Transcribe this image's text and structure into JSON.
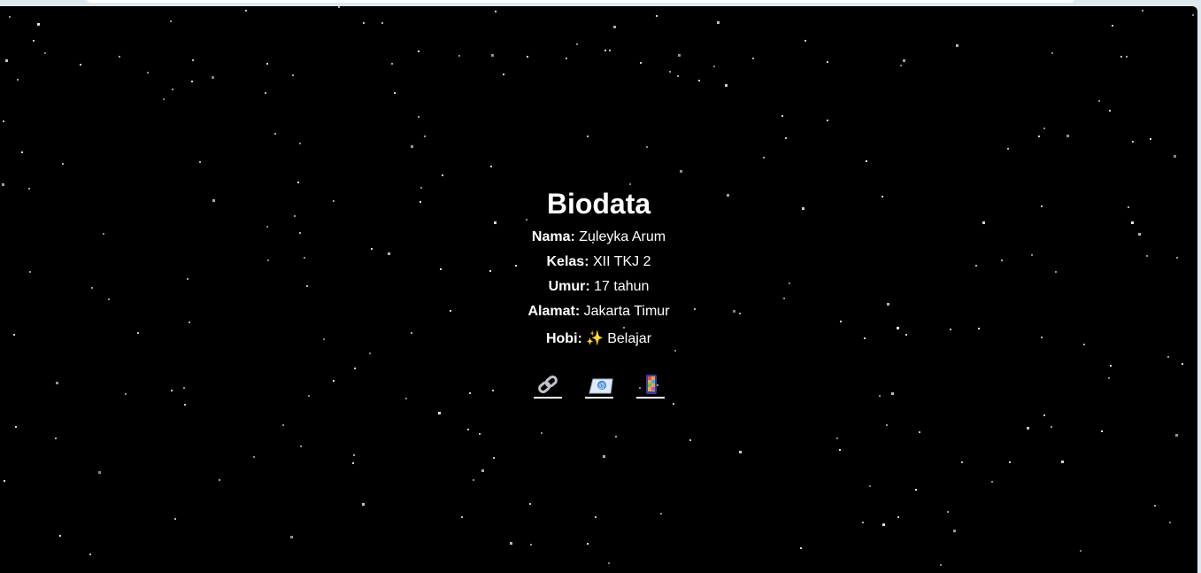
{
  "biodata": {
    "title": "Biodata",
    "rows": [
      {
        "label": "Nama:",
        "value": "Zuleyka Arum"
      },
      {
        "label": "Kelas:",
        "value": "XII TKJ 2"
      },
      {
        "label": "Umur:",
        "value": "17 tahun"
      },
      {
        "label": "Alamat:",
        "value": "Jakarta Timur"
      }
    ],
    "hobi": {
      "label": "Hobi:",
      "icon": "sparkles-icon",
      "value": "Belajar"
    }
  },
  "links": [
    {
      "icon": "link-icon"
    },
    {
      "icon": "email-icon"
    },
    {
      "icon": "phone-icon"
    }
  ],
  "colors": {
    "background": "#000000",
    "text": "#ffffff",
    "star": "#e8e8e8",
    "chrome": "#dde9ee"
  }
}
